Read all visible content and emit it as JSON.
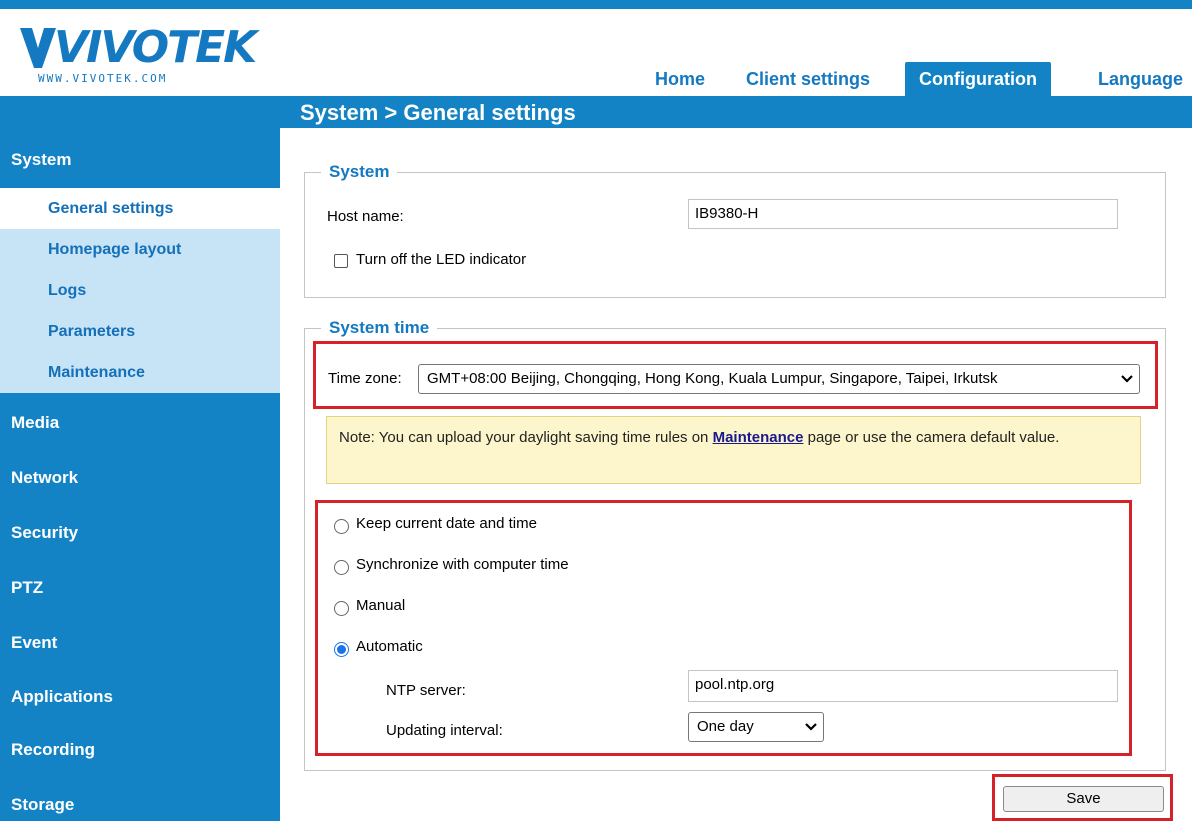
{
  "brand": {
    "logo_text": "VIVOTEK",
    "logo_url": "WWW.VIVOTEK.COM"
  },
  "nav": {
    "items": [
      {
        "label": "Home"
      },
      {
        "label": "Client settings"
      },
      {
        "label": "Configuration",
        "active": true
      },
      {
        "label": "Language"
      }
    ]
  },
  "breadcrumb": "System  > General settings",
  "sidebar": {
    "system_label": "System",
    "sub_items": [
      {
        "label": "General settings",
        "active": true
      },
      {
        "label": "Homepage layout"
      },
      {
        "label": "Logs"
      },
      {
        "label": "Parameters"
      },
      {
        "label": "Maintenance"
      }
    ],
    "main_items": [
      {
        "label": "Media"
      },
      {
        "label": "Network"
      },
      {
        "label": "Security"
      },
      {
        "label": "PTZ"
      },
      {
        "label": "Event"
      },
      {
        "label": "Applications"
      },
      {
        "label": "Recording"
      },
      {
        "label": "Storage"
      }
    ]
  },
  "system_section": {
    "legend": "System",
    "host_name_label": "Host name:",
    "host_name_value": "IB9380-H",
    "led_checkbox_label": "Turn off the LED indicator",
    "led_checked": false
  },
  "system_time_section": {
    "legend": "System time",
    "timezone_label": "Time zone:",
    "timezone_value": "GMT+08:00 Beijing, Chongqing, Hong Kong, Kuala Lumpur, Singapore, Taipei, Irkutsk",
    "note_prefix": "Note: You can upload your daylight saving time rules on ",
    "note_link": "Maintenance",
    "note_suffix": " page or use the camera default value.",
    "options": [
      {
        "label": "Keep current date and time",
        "checked": false
      },
      {
        "label": "Synchronize with computer time",
        "checked": false
      },
      {
        "label": "Manual",
        "checked": false
      },
      {
        "label": "Automatic",
        "checked": true
      }
    ],
    "ntp_label": "NTP server:",
    "ntp_value": "pool.ntp.org",
    "interval_label": "Updating interval:",
    "interval_value": "One day"
  },
  "actions": {
    "save_label": "Save"
  },
  "colors": {
    "primary": "#1383c6",
    "sub_bg": "#c7e4f6",
    "highlight": "#d62128",
    "note_bg": "#fdf5cc"
  }
}
